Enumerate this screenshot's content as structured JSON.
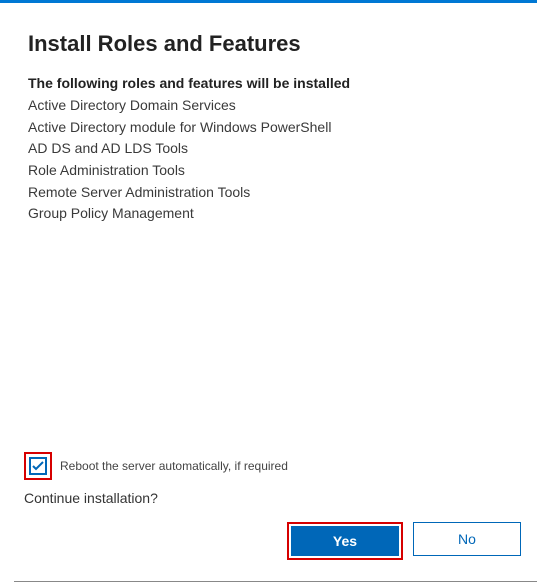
{
  "dialog": {
    "title": "Install Roles and Features",
    "subhead": "The following roles and features will be installed",
    "features": [
      "Active Directory Domain Services",
      "Active Directory module for Windows PowerShell",
      "AD DS and AD LDS Tools",
      "Role Administration Tools",
      "Remote Server Administration Tools",
      "Group Policy Management"
    ],
    "reboot_label": "Reboot the server automatically, if required",
    "reboot_checked": true,
    "prompt": "Continue installation?",
    "yes_label": "Yes",
    "no_label": "No"
  }
}
